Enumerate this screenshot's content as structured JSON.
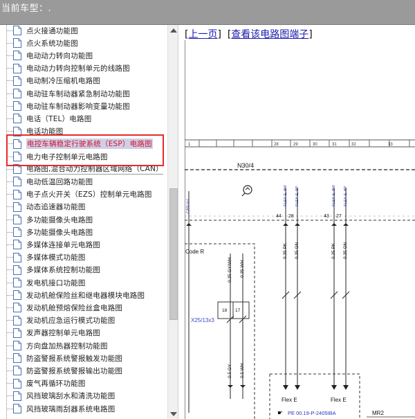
{
  "header": {
    "title": "当前车型：."
  },
  "sidebar": {
    "items": [
      {
        "label": "点火接通功能图"
      },
      {
        "label": "点火系统功能图"
      },
      {
        "label": "电动动力转向功能图"
      },
      {
        "label": "电动动力转向控制单元的线路图"
      },
      {
        "label": "电动制冷压缩机电路图"
      },
      {
        "label": "电动驻车制动器紧急制动功能图"
      },
      {
        "label": "电动驻车制动器影响变量功能图"
      },
      {
        "label": "电话（TEL）电路图"
      },
      {
        "label": "电话功能图"
      },
      {
        "label": "电控车辆稳定行驶系统（ESP）电路图"
      },
      {
        "label": "电力电子控制单元电路图"
      },
      {
        "label": "电路图,混合动力控制器区域网络（CAN）"
      },
      {
        "label": "电动低温回路功能图"
      },
      {
        "label": "电子点火开关（EZS）控制单元电路图"
      },
      {
        "label": "动态追速器功能图"
      },
      {
        "label": "多功能摄像头电路图"
      },
      {
        "label": "多功能摄像头电路图"
      },
      {
        "label": "多媒体连接单元电路图"
      },
      {
        "label": "多媒体模式功能图"
      },
      {
        "label": "多媒体系统控制功能图"
      },
      {
        "label": "发电机接口功能图"
      },
      {
        "label": "发动机舱保险丝和继电器模块电路图"
      },
      {
        "label": "发动机舱预熔保险丝盒电路图"
      },
      {
        "label": "发动机应急运行模式功能图"
      },
      {
        "label": "发声器控制单元电路图"
      },
      {
        "label": "方向盘加热器控制功能图"
      },
      {
        "label": "防盗警报系统警报触发功能图"
      },
      {
        "label": "防盗警报系统警报输出功能图"
      },
      {
        "label": "废气再循环功能图"
      },
      {
        "label": "风挡玻璃刮水和清洗功能图"
      },
      {
        "label": "风挡玻璃雨刮器系统电路图"
      }
    ],
    "selected_index": 9
  },
  "main": {
    "links": {
      "up_level": "上一页",
      "view_terminals": "查看该电路图端子"
    },
    "diagram": {
      "ruler_numbers": [
        "28",
        "29",
        "30",
        "31",
        "32",
        "33"
      ],
      "component": "N30/4",
      "bus_label": "CAN H-L",
      "wire_labels_top": [
        "FLEX-E, BM",
        "FLEX-E, BP",
        "FLEX-E, BM",
        "FLEX-E, BP"
      ],
      "pins_top": [
        "44",
        "28",
        "43",
        "27"
      ],
      "code_label": "Code R",
      "wire_labels_mid": [
        "0.35 PK",
        "0.35 GN",
        "0.35 PK",
        "0.35 GN"
      ],
      "left_wires_top": [
        "0.35 GY/WH",
        "0.35 WH"
      ],
      "connector_pins": [
        "18",
        "17"
      ],
      "connector_label": "X25/13x3",
      "left_wires_bottom": [
        "0.5 GY",
        "0.5 WH"
      ],
      "flex_labels": [
        "Flex E",
        "Flex E"
      ],
      "reference": "PE 00.19-P-2405IBA",
      "mr_label": "MR2"
    }
  }
}
